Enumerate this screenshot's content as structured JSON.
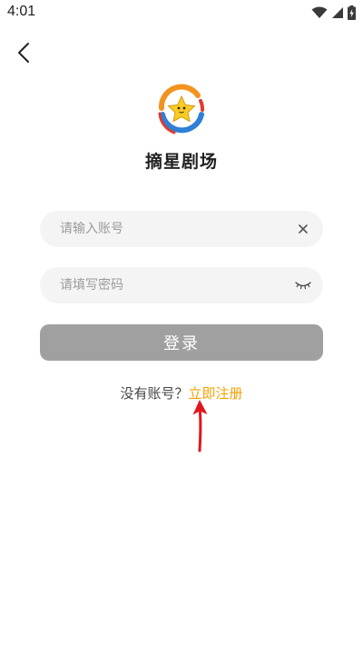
{
  "status_bar": {
    "time": "4:01",
    "icons": [
      "wifi-icon",
      "cell-signal-icon",
      "battery-charging-icon"
    ]
  },
  "header": {
    "back_icon": "chevron-left-icon"
  },
  "app": {
    "name": "摘星剧场",
    "logo_icon": "star-logo-icon"
  },
  "form": {
    "account": {
      "placeholder": "请输入账号",
      "value": "",
      "clear_icon": "close-icon"
    },
    "password": {
      "placeholder": "请填写密码",
      "value": "",
      "toggle_icon": "eye-closed-icon"
    },
    "login_label": "登录"
  },
  "register": {
    "prompt": "没有账号？",
    "link": "立即注册"
  },
  "colors": {
    "accent": "#f5a000",
    "login_button": "#a0a0a0",
    "field_background": "#f4f4f4",
    "annotation_arrow": "#e0161b"
  }
}
